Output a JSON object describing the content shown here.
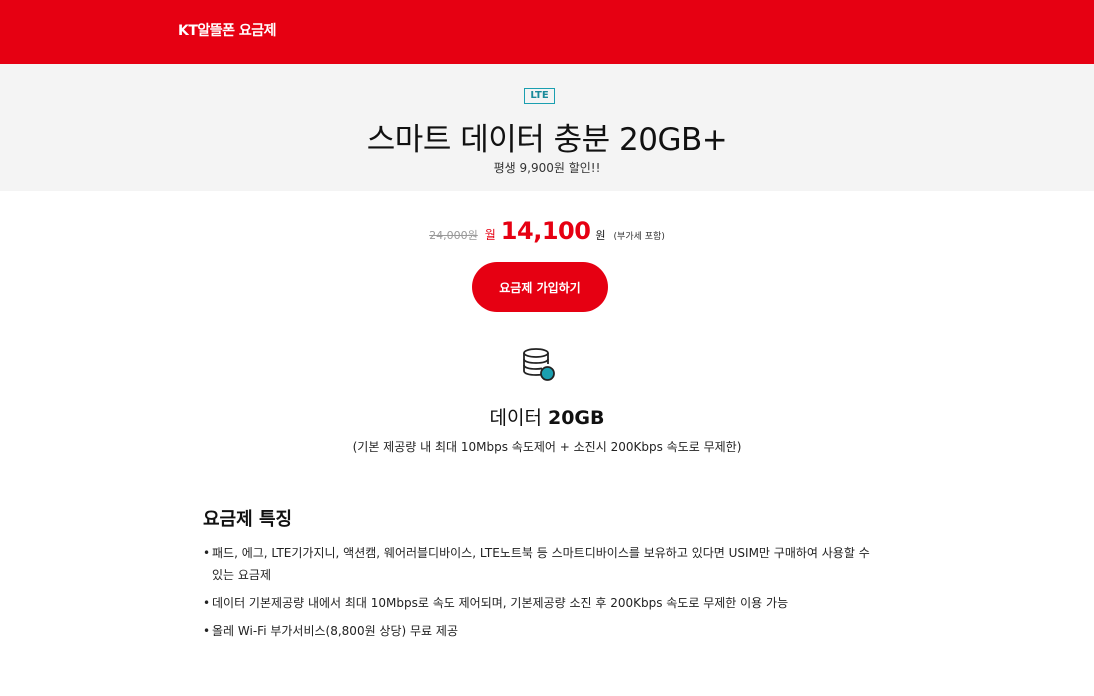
{
  "header": {
    "brand": "KT알뜰폰 요금제"
  },
  "hero": {
    "badge": "LTE",
    "title": "스마트 데이터 충분 20GB+",
    "subtitle": "평생 9,900원 할인!!"
  },
  "pricing": {
    "original": "24,000원",
    "period": "월",
    "price": "14,100",
    "unit": "원",
    "vat_note": "(부가세 포함)"
  },
  "join_button": {
    "label": "요금제 가입하기"
  },
  "data_info": {
    "icon": "database-icon",
    "label": "데이터",
    "amount": "20GB",
    "note": "(기본 제공량 내 최대 10Mbps 속도제어 + 소진시 200Kbps 속도로 무제한)"
  },
  "features": {
    "title": "요금제 특징",
    "items": [
      "패드, 에그, LTE기가지니, 액션캠, 웨어러블디바이스, LTE노트북 등 스마트디바이스를 보유하고 있다면 USIM만 구매하여 사용할 수 있는 요금제",
      "데이터 기본제공량 내에서 최대 10Mbps로 속도 제어되며, 기본제공량 소진 후 200Kbps 속도로 무제한 이용 가능",
      "올레 Wi-Fi 부가서비스(8,800원 상당) 무료 제공"
    ]
  },
  "colors": {
    "brand_red": "#e60012",
    "accent_teal": "#1a9fb0",
    "hero_bg": "#f4f4f4"
  }
}
